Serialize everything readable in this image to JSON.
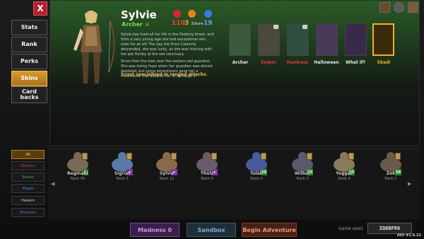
{
  "close_label": "X",
  "sidebar": {
    "items": [
      {
        "label": "Stats",
        "active": false
      },
      {
        "label": "Rank",
        "active": false
      },
      {
        "label": "Perks",
        "active": false
      },
      {
        "label": "Skins",
        "active": true
      },
      {
        "label": "Card backs",
        "active": false
      }
    ]
  },
  "hero": {
    "name": "Sylvie",
    "class": "Archer",
    "stats": {
      "health": "110",
      "speed": "3",
      "speed_unit": "3/turn",
      "resist": "19"
    },
    "description": [
      "Sylvie has lived all her life in the Faeborg forest, and from a very young age she had exceptional aim, even for an elf. The day the Frost Calamity descended, she was lucky, as she was training with her pet Harley at the owl sanctuary.",
      "Since then the took over the eastern owl guardian. She was losing hope when her guardian was almost depleted, but some adventurers gave her a moonstone that allowed her to recharge it."
    ],
    "subtitle": "Scout specialized in ranged attacks."
  },
  "skins": [
    {
      "label": "Archer",
      "color": "#ffffff",
      "locked": false,
      "selected": false
    },
    {
      "label": "Sniper",
      "color": "#e03a3a",
      "locked": true,
      "selected": false
    },
    {
      "label": "Huntress",
      "color": "#e03a3a",
      "locked": true,
      "selected": false
    },
    {
      "label": "Halloween",
      "color": "#ffffff",
      "locked": false,
      "selected": false
    },
    {
      "label": "What if?",
      "color": "#ffffff",
      "locked": false,
      "selected": false
    },
    {
      "label": "Skadi",
      "color": "#f2b01e",
      "locked": false,
      "selected": true
    }
  ],
  "filters": [
    {
      "label": "All",
      "active": true
    },
    {
      "label": "Warriors",
      "active": false
    },
    {
      "label": "Scouts",
      "active": false
    },
    {
      "label": "Mages",
      "active": false
    },
    {
      "label": "Healers",
      "active": false
    },
    {
      "label": "Monsters",
      "active": false
    }
  ],
  "roster": [
    {
      "name": "Reginald",
      "rank": "Rank 50",
      "badge": "1",
      "badge_color": "#2e8a2e",
      "color": "#7a6a55"
    },
    {
      "name": "Sigrun",
      "rank": "Rank 0",
      "badge": "★",
      "badge_color": "#7a3aa0",
      "color": "#5a7aa5"
    },
    {
      "name": "Sylvie",
      "rank": "Rank 12",
      "badge": "★",
      "badge_color": "#7a3aa0",
      "color": "#8a6a4a"
    },
    {
      "name": "Thuls",
      "rank": "Rank 0",
      "badge": "★",
      "badge_color": "#7a3aa0",
      "color": "#6a5a6a"
    },
    {
      "name": "Tulah",
      "rank": "Rank 0",
      "badge": "50",
      "badge_color": "#2e8a2e",
      "color": "#4a5a9a"
    },
    {
      "name": "Wilbur",
      "rank": "Rank 0",
      "badge": "50",
      "badge_color": "#2e8a2e",
      "color": "#5a5a6a"
    },
    {
      "name": "Yogger",
      "rank": "Rank 0",
      "badge": "50",
      "badge_color": "#2e8a2e",
      "color": "#8a7a5a"
    },
    {
      "name": "Zek",
      "rank": "Rank 1",
      "badge": "50",
      "badge_color": "#2e8a2e",
      "color": "#6a5a4a"
    }
  ],
  "buttons": {
    "madness": "Madness 0",
    "sandbox": "Sandbox",
    "begin": "Begin Adventure"
  },
  "seed": {
    "label": "Game seed",
    "value": "ZQ6BFR6"
  },
  "version": "AtO #1.6.22",
  "colors": {
    "accent": "#d99b2e",
    "close": "#b51f2b",
    "panel_green": "#2b5a27"
  }
}
